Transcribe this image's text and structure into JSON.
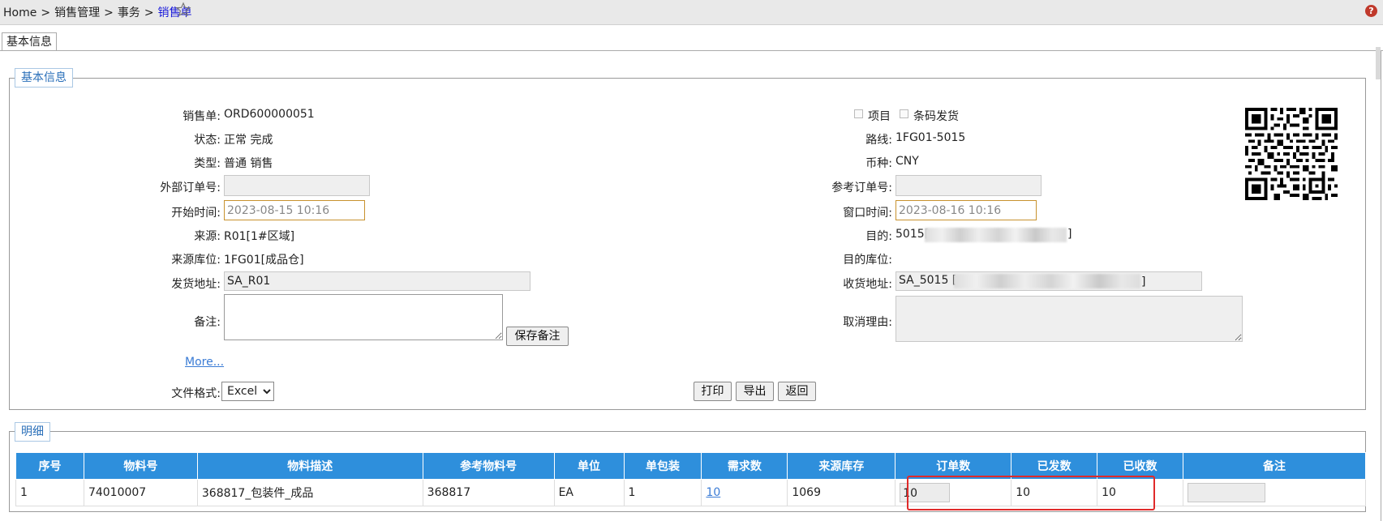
{
  "breadcrumb": {
    "home": "Home",
    "sep": ">",
    "level1": "销售管理",
    "level2": "事务",
    "current": "销售单"
  },
  "tabs": [
    {
      "label": "基本信息"
    }
  ],
  "section_basic": {
    "legend": "基本信息",
    "left": {
      "order_label": "销售单:",
      "order_value": "ORD600000051",
      "status_label": "状态:",
      "status_value": "正常 完成",
      "type_label": "类型:",
      "type_value": "普通 销售",
      "ext_order_label": "外部订单号:",
      "ext_order_value": "",
      "start_time_label": "开始时间:",
      "start_time_value": "2023-08-15 10:16",
      "source_label": "来源:",
      "source_value": "R01[1#区域]",
      "source_loc_label": "来源库位:",
      "source_loc_value": "1FG01[成品仓]",
      "ship_addr_label": "发货地址:",
      "ship_addr_value": "SA_R01",
      "remark_label": "备注:",
      "remark_value": "",
      "save_remark_button": "保存备注",
      "more_link": "More...",
      "file_format_label": "文件格式:",
      "file_format_selected": "Excel"
    },
    "right": {
      "project_label": "项目",
      "barcode_ship_label": "条码发货",
      "route_label": "路线:",
      "route_value": "1FG01-5015",
      "currency_label": "币种:",
      "currency_value": "CNY",
      "ref_order_label": "参考订单号:",
      "ref_order_value": "",
      "window_time_label": "窗口时间:",
      "window_time_value": "2023-08-16 10:16",
      "dest_label": "目的:",
      "dest_value": "5015[",
      "dest_value_end": "]",
      "dest_loc_label": "目的库位:",
      "dest_loc_value": "",
      "recv_addr_label": "收货地址:",
      "recv_addr_value": "SA_5015 [",
      "recv_addr_value_end": "]",
      "cancel_reason_label": "取消理由:",
      "cancel_reason_value": ""
    },
    "actions": {
      "print": "打印",
      "export": "导出",
      "back": "返回"
    }
  },
  "section_detail": {
    "legend": "明细",
    "columns": [
      "序号",
      "物料号",
      "物料描述",
      "参考物料号",
      "单位",
      "单包装",
      "需求数",
      "来源库存",
      "订单数",
      "已发数",
      "已收数",
      "备注"
    ],
    "rows": [
      {
        "seq": "1",
        "item_no": "74010007",
        "desc": "368817_包装件_成品",
        "ref_item": "368817",
        "unit": "EA",
        "pack": "1",
        "demand": "10",
        "source_stock": "1069",
        "order_qty": "10",
        "shipped": "10",
        "received": "10",
        "remark": ""
      }
    ]
  },
  "colors": {
    "header_blue": "#2e8fdc",
    "legend_text": "#2a6fb9",
    "highlight_red": "#e02a2a",
    "date_border": "#c8922e"
  },
  "icons": {
    "favorite": "star-outline-icon",
    "help": "help-icon",
    "qr": "qr-code"
  }
}
